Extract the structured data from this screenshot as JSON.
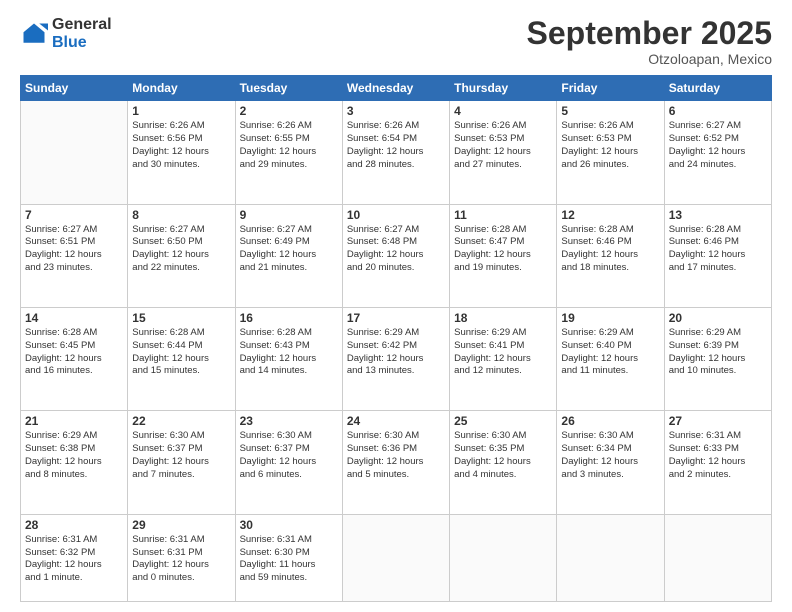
{
  "logo": {
    "general": "General",
    "blue": "Blue"
  },
  "header": {
    "month": "September 2025",
    "location": "Otzoloapan, Mexico"
  },
  "weekdays": [
    "Sunday",
    "Monday",
    "Tuesday",
    "Wednesday",
    "Thursday",
    "Friday",
    "Saturday"
  ],
  "weeks": [
    [
      {
        "day": "",
        "info": ""
      },
      {
        "day": "1",
        "info": "Sunrise: 6:26 AM\nSunset: 6:56 PM\nDaylight: 12 hours\nand 30 minutes."
      },
      {
        "day": "2",
        "info": "Sunrise: 6:26 AM\nSunset: 6:55 PM\nDaylight: 12 hours\nand 29 minutes."
      },
      {
        "day": "3",
        "info": "Sunrise: 6:26 AM\nSunset: 6:54 PM\nDaylight: 12 hours\nand 28 minutes."
      },
      {
        "day": "4",
        "info": "Sunrise: 6:26 AM\nSunset: 6:53 PM\nDaylight: 12 hours\nand 27 minutes."
      },
      {
        "day": "5",
        "info": "Sunrise: 6:26 AM\nSunset: 6:53 PM\nDaylight: 12 hours\nand 26 minutes."
      },
      {
        "day": "6",
        "info": "Sunrise: 6:27 AM\nSunset: 6:52 PM\nDaylight: 12 hours\nand 24 minutes."
      }
    ],
    [
      {
        "day": "7",
        "info": "Sunrise: 6:27 AM\nSunset: 6:51 PM\nDaylight: 12 hours\nand 23 minutes."
      },
      {
        "day": "8",
        "info": "Sunrise: 6:27 AM\nSunset: 6:50 PM\nDaylight: 12 hours\nand 22 minutes."
      },
      {
        "day": "9",
        "info": "Sunrise: 6:27 AM\nSunset: 6:49 PM\nDaylight: 12 hours\nand 21 minutes."
      },
      {
        "day": "10",
        "info": "Sunrise: 6:27 AM\nSunset: 6:48 PM\nDaylight: 12 hours\nand 20 minutes."
      },
      {
        "day": "11",
        "info": "Sunrise: 6:28 AM\nSunset: 6:47 PM\nDaylight: 12 hours\nand 19 minutes."
      },
      {
        "day": "12",
        "info": "Sunrise: 6:28 AM\nSunset: 6:46 PM\nDaylight: 12 hours\nand 18 minutes."
      },
      {
        "day": "13",
        "info": "Sunrise: 6:28 AM\nSunset: 6:46 PM\nDaylight: 12 hours\nand 17 minutes."
      }
    ],
    [
      {
        "day": "14",
        "info": "Sunrise: 6:28 AM\nSunset: 6:45 PM\nDaylight: 12 hours\nand 16 minutes."
      },
      {
        "day": "15",
        "info": "Sunrise: 6:28 AM\nSunset: 6:44 PM\nDaylight: 12 hours\nand 15 minutes."
      },
      {
        "day": "16",
        "info": "Sunrise: 6:28 AM\nSunset: 6:43 PM\nDaylight: 12 hours\nand 14 minutes."
      },
      {
        "day": "17",
        "info": "Sunrise: 6:29 AM\nSunset: 6:42 PM\nDaylight: 12 hours\nand 13 minutes."
      },
      {
        "day": "18",
        "info": "Sunrise: 6:29 AM\nSunset: 6:41 PM\nDaylight: 12 hours\nand 12 minutes."
      },
      {
        "day": "19",
        "info": "Sunrise: 6:29 AM\nSunset: 6:40 PM\nDaylight: 12 hours\nand 11 minutes."
      },
      {
        "day": "20",
        "info": "Sunrise: 6:29 AM\nSunset: 6:39 PM\nDaylight: 12 hours\nand 10 minutes."
      }
    ],
    [
      {
        "day": "21",
        "info": "Sunrise: 6:29 AM\nSunset: 6:38 PM\nDaylight: 12 hours\nand 8 minutes."
      },
      {
        "day": "22",
        "info": "Sunrise: 6:30 AM\nSunset: 6:37 PM\nDaylight: 12 hours\nand 7 minutes."
      },
      {
        "day": "23",
        "info": "Sunrise: 6:30 AM\nSunset: 6:37 PM\nDaylight: 12 hours\nand 6 minutes."
      },
      {
        "day": "24",
        "info": "Sunrise: 6:30 AM\nSunset: 6:36 PM\nDaylight: 12 hours\nand 5 minutes."
      },
      {
        "day": "25",
        "info": "Sunrise: 6:30 AM\nSunset: 6:35 PM\nDaylight: 12 hours\nand 4 minutes."
      },
      {
        "day": "26",
        "info": "Sunrise: 6:30 AM\nSunset: 6:34 PM\nDaylight: 12 hours\nand 3 minutes."
      },
      {
        "day": "27",
        "info": "Sunrise: 6:31 AM\nSunset: 6:33 PM\nDaylight: 12 hours\nand 2 minutes."
      }
    ],
    [
      {
        "day": "28",
        "info": "Sunrise: 6:31 AM\nSunset: 6:32 PM\nDaylight: 12 hours\nand 1 minute."
      },
      {
        "day": "29",
        "info": "Sunrise: 6:31 AM\nSunset: 6:31 PM\nDaylight: 12 hours\nand 0 minutes."
      },
      {
        "day": "30",
        "info": "Sunrise: 6:31 AM\nSunset: 6:30 PM\nDaylight: 11 hours\nand 59 minutes."
      },
      {
        "day": "",
        "info": ""
      },
      {
        "day": "",
        "info": ""
      },
      {
        "day": "",
        "info": ""
      },
      {
        "day": "",
        "info": ""
      }
    ]
  ]
}
